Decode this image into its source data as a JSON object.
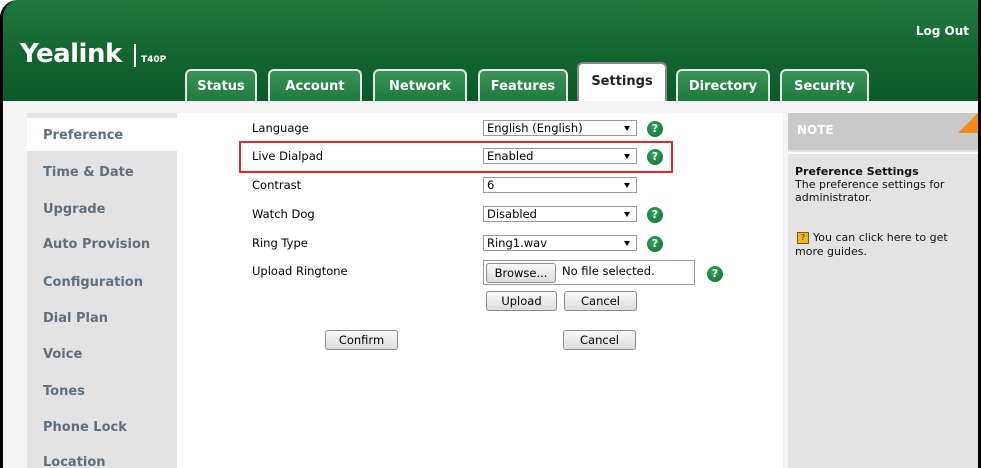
{
  "header": {
    "brand": "Yealink",
    "model": "T40P",
    "logout": "Log Out"
  },
  "tabs": [
    {
      "label": "Status"
    },
    {
      "label": "Account"
    },
    {
      "label": "Network"
    },
    {
      "label": "Features"
    },
    {
      "label": "Settings",
      "active": true
    },
    {
      "label": "Directory"
    },
    {
      "label": "Security"
    }
  ],
  "sidebar": {
    "items": [
      {
        "label": "Preference",
        "active": true
      },
      {
        "label": "Time & Date"
      },
      {
        "label": "Upgrade"
      },
      {
        "label": "Auto Provision"
      },
      {
        "label": "Configuration"
      },
      {
        "label": "Dial Plan"
      },
      {
        "label": "Voice"
      },
      {
        "label": "Tones"
      },
      {
        "label": "Phone Lock"
      },
      {
        "label": "Location"
      }
    ]
  },
  "form": {
    "language": {
      "label": "Language",
      "value": "English (English)"
    },
    "live_dialpad": {
      "label": "Live Dialpad",
      "value": "Enabled"
    },
    "contrast": {
      "label": "Contrast",
      "value": "6"
    },
    "watch_dog": {
      "label": "Watch Dog",
      "value": "Disabled"
    },
    "ring_type": {
      "label": "Ring Type",
      "value": "Ring1.wav"
    },
    "upload_ringtone": {
      "label": "Upload Ringtone",
      "browse": "Browse...",
      "file_status": "No file selected.",
      "upload": "Upload",
      "cancel": "Cancel"
    },
    "confirm": "Confirm",
    "cancel": "Cancel",
    "help_glyph": "?"
  },
  "note": {
    "title": "NOTE",
    "heading": "Preference Settings",
    "line1": "The preference settings for",
    "line2": "administrator.",
    "guide1": "You can click here to get",
    "guide2": "more guides."
  },
  "colors": {
    "header_green": "#136530",
    "nav_text": "#5d7080",
    "highlight": "#e3262b",
    "note_corner": "#f38b1a"
  }
}
